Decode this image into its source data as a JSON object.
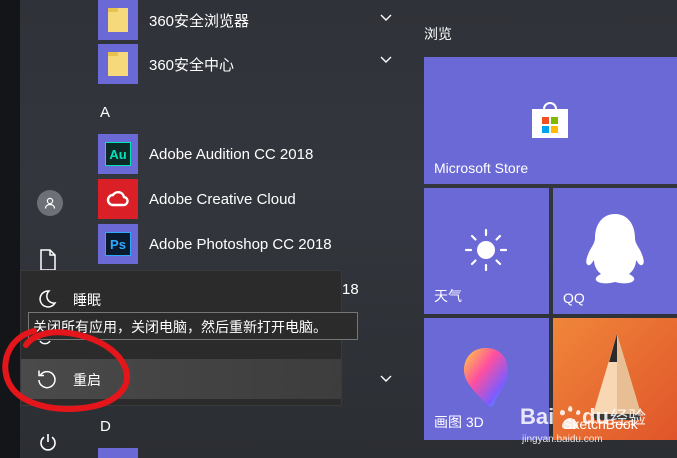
{
  "start_menu": {
    "apps": [
      {
        "label": "360安全浏览器",
        "icon": "folder-icon",
        "expandable": true
      },
      {
        "label": "360安全中心",
        "icon": "folder-icon",
        "expandable": true
      },
      {
        "label": "Adobe Audition CC 2018",
        "icon": "audition-icon",
        "badge": "Au"
      },
      {
        "label": "Adobe Creative Cloud",
        "icon": "creative-cloud-icon"
      },
      {
        "label": "Adobe Photoshop CC 2018",
        "icon": "photoshop-icon",
        "badge": "Ps"
      }
    ],
    "letters": [
      "A",
      "D"
    ],
    "partial_text": "18",
    "colors": {
      "tile_purple": "#6b69d6",
      "audition_bg": "#00e4bb",
      "cc_red": "#da1f26",
      "ps_blue": "#31a8ff"
    }
  },
  "tiles": {
    "header": "浏览",
    "items": [
      {
        "name": "Microsoft Store",
        "icon": "store-bag-icon"
      },
      {
        "name": "天气",
        "icon": "sun-icon"
      },
      {
        "name": "QQ",
        "icon": "penguin-icon"
      },
      {
        "name": "画图 3D",
        "icon": "paint3d-drop-icon"
      },
      {
        "name": "SketchBook",
        "icon": "pencil-icon"
      }
    ]
  },
  "power_menu": {
    "items": [
      {
        "label": "睡眠",
        "icon": "moon-icon"
      },
      {
        "label": "重启",
        "icon": "restart-icon"
      }
    ],
    "tooltip": "关闭所有应用，关闭电脑，然后重新打开电脑。"
  },
  "watermark": {
    "brand": "Baidu经验",
    "url": "jingyan.baidu.com"
  }
}
